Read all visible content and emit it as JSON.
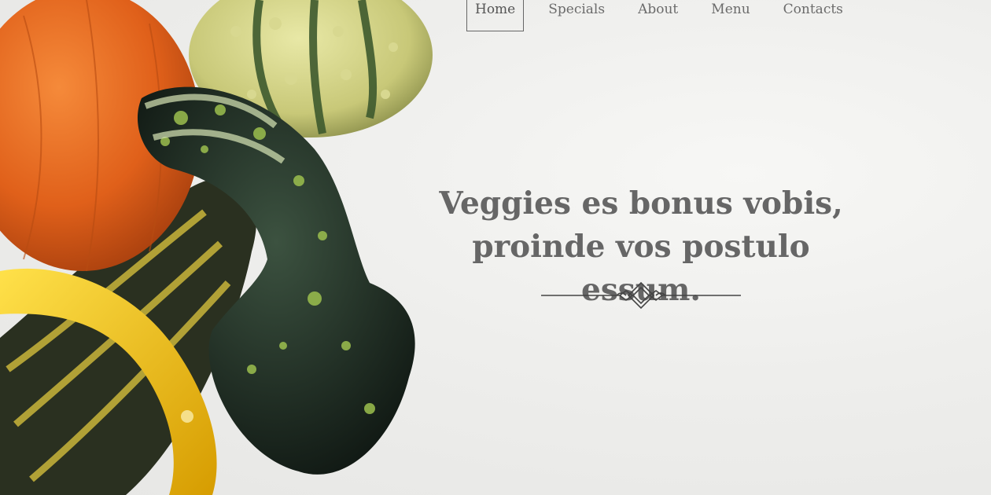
{
  "nav": {
    "items": [
      {
        "label": "Home",
        "active": true
      },
      {
        "label": "Specials",
        "active": false
      },
      {
        "label": "About",
        "active": false
      },
      {
        "label": "Menu",
        "active": false
      },
      {
        "label": "Contacts",
        "active": false
      }
    ]
  },
  "hero": {
    "headline_line1": "Veggies es bonus vobis,",
    "headline_line2": "proinde vos postulo essum."
  },
  "colors": {
    "background": "#ececea",
    "text": "#666666",
    "pumpkin": "#e0601a",
    "squash_yellow": "#f0c81e",
    "gourd_green": "#1f2d22"
  },
  "icons": {
    "divider": "ornamental-divider-icon"
  }
}
